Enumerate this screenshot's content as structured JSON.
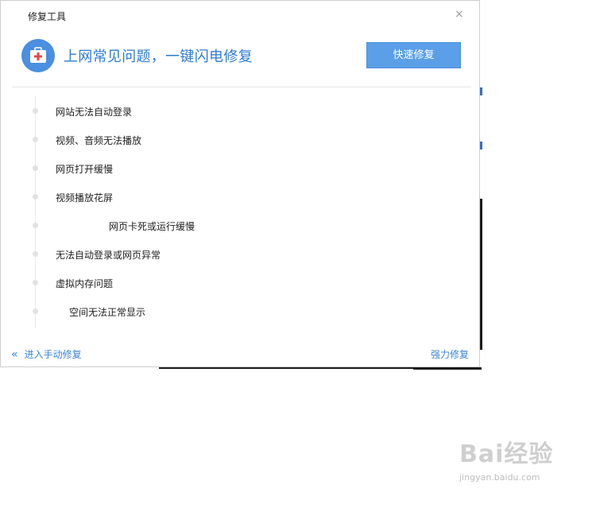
{
  "dialog": {
    "title": "修复工具",
    "close_glyph": "×",
    "headline": "上网常见问题，一键闪电修复",
    "quick_fix_label": "快速修复",
    "header_icon": "first-aid-kit-icon"
  },
  "issues": [
    "网站无法自动登录",
    "视频、音频无法播放",
    "网页打开缓慢",
    "视频播放花屏",
    "网页卡死或运行缓慢",
    "无法自动登录或网页异常",
    "虚拟内存问题",
    "空间无法正常显示"
  ],
  "footer": {
    "manual_glyph": "«",
    "manual_label": "进入手动修复",
    "strong_label": "强力修复"
  },
  "watermark": {
    "brand": "Bai经验",
    "url": "jingyan.baidu.com"
  },
  "colors": {
    "accent": "#2e7bd6",
    "button": "#5b9fe8",
    "icon_circle": "#4a8fe0",
    "cross": "#e24a4a"
  }
}
